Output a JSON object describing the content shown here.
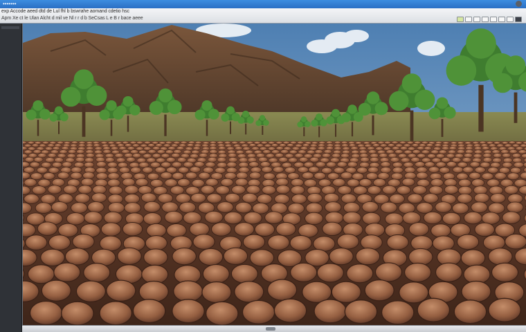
{
  "window": {
    "title": "•••••••",
    "menu_line_1": "exp Accode aeed dtd de Lul fhl b bswrahe aomand cdetio hsc",
    "menu_line_2": "Apm Xe ct le Ulan Alcht  d mil ve Nl r r d b SeCsas L e B r bace aeee"
  },
  "toolbar": {
    "buttons": [
      "tool-1",
      "tool-2",
      "tool-3",
      "tool-4",
      "tool-5",
      "tool-6",
      "tool-7",
      "tool-8"
    ]
  },
  "viewport": {
    "scene": "rendered terrain with cobblestone ground, trees and mountains"
  },
  "colors": {
    "title_bar": "#2f7ad4",
    "sky": "#6e9ec8",
    "mountain": "#6a4c35",
    "ground": "#8a5a3f",
    "tree": "#3c7a2e"
  }
}
